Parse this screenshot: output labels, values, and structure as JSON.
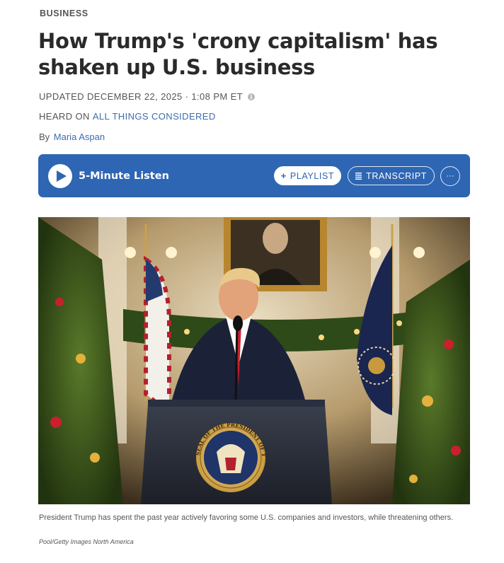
{
  "section": {
    "label": "BUSINESS"
  },
  "headline": "How Trump's 'crony capitalism' has shaken up U.S. business",
  "meta": {
    "updated": "UPDATED DECEMBER 22, 2025 · 1:08 PM ET",
    "heard_prefix": "HEARD ON",
    "program": "ALL THINGS CONSIDERED",
    "info_icon": "info-icon"
  },
  "byline": {
    "prefix": "By",
    "author": "Maria Aspan"
  },
  "audio": {
    "duration_label": "5-Minute Listen",
    "playlist_label": "PLAYLIST",
    "transcript_label": "TRANSCRIPT",
    "more_label": "···",
    "bar_color": "#2e66b3"
  },
  "image": {
    "caption": "President Trump has spent the past year actively favoring some U.S. companies and investors, while threatening others.",
    "credit": "Pool/Getty Images North America",
    "seal_text": "SEAL OF THE PRESIDENT OF THE UNITED STATES"
  }
}
